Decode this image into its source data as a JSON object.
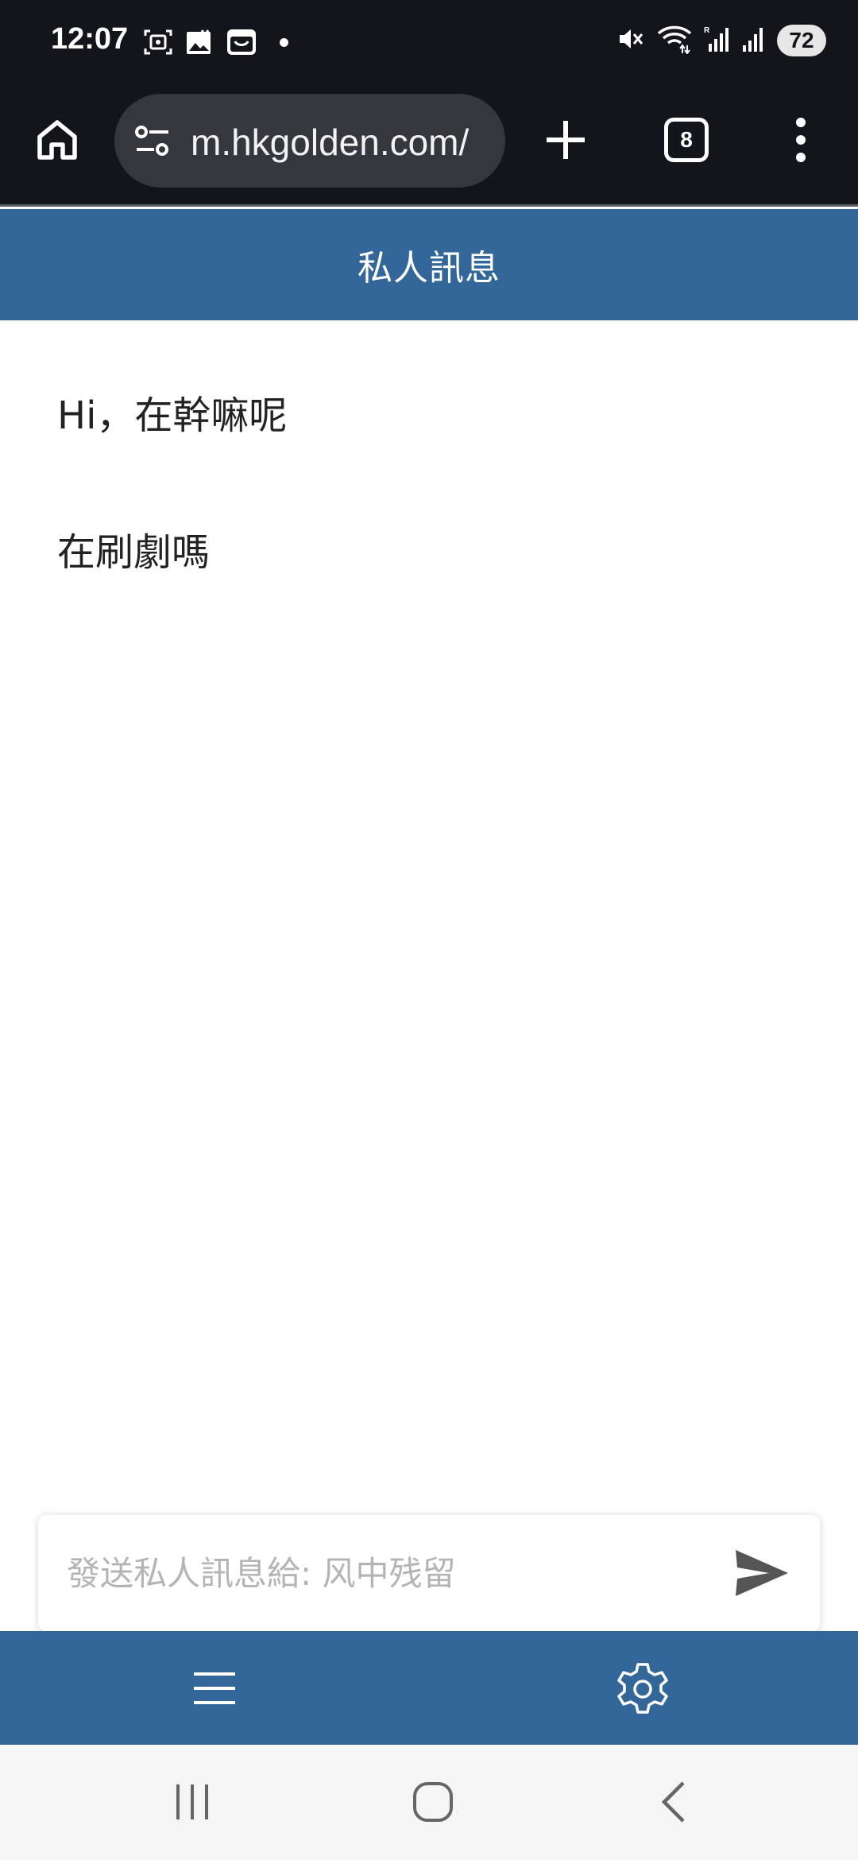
{
  "status_bar": {
    "time": "12:07",
    "battery": "72",
    "icons": [
      "screenshot-icon",
      "gallery-icon",
      "shop-icon",
      "notification-dot",
      "mute-icon",
      "wifi-icon",
      "signal-r-icon",
      "signal-icon",
      "battery-icon"
    ]
  },
  "browser": {
    "url": "m.hkgolden.com/",
    "tab_count": "8",
    "icons": [
      "home-icon",
      "tune-icon",
      "plus-icon",
      "more-vert-icon"
    ]
  },
  "header": {
    "title": "私人訊息"
  },
  "messages": [
    {
      "text": "Hi，在幹嘛呢"
    },
    {
      "text": "在刷劇嗎"
    }
  ],
  "compose": {
    "placeholder": "發送私人訊息給: 风中残留",
    "value": "",
    "send_icon": "send-icon"
  },
  "bottom_nav": {
    "icons": [
      "hamburger-menu-icon",
      "settings-gear-icon"
    ]
  },
  "system_nav": {
    "icons": [
      "recents-icon",
      "home-circle-icon",
      "back-icon"
    ]
  },
  "colors": {
    "status_bg": "#14151a",
    "url_bar_bg": "#35373c",
    "brand_blue": "#336699",
    "system_nav_bg": "#f4f5f4",
    "placeholder": "#b4b4b4",
    "message_text": "#222222"
  }
}
